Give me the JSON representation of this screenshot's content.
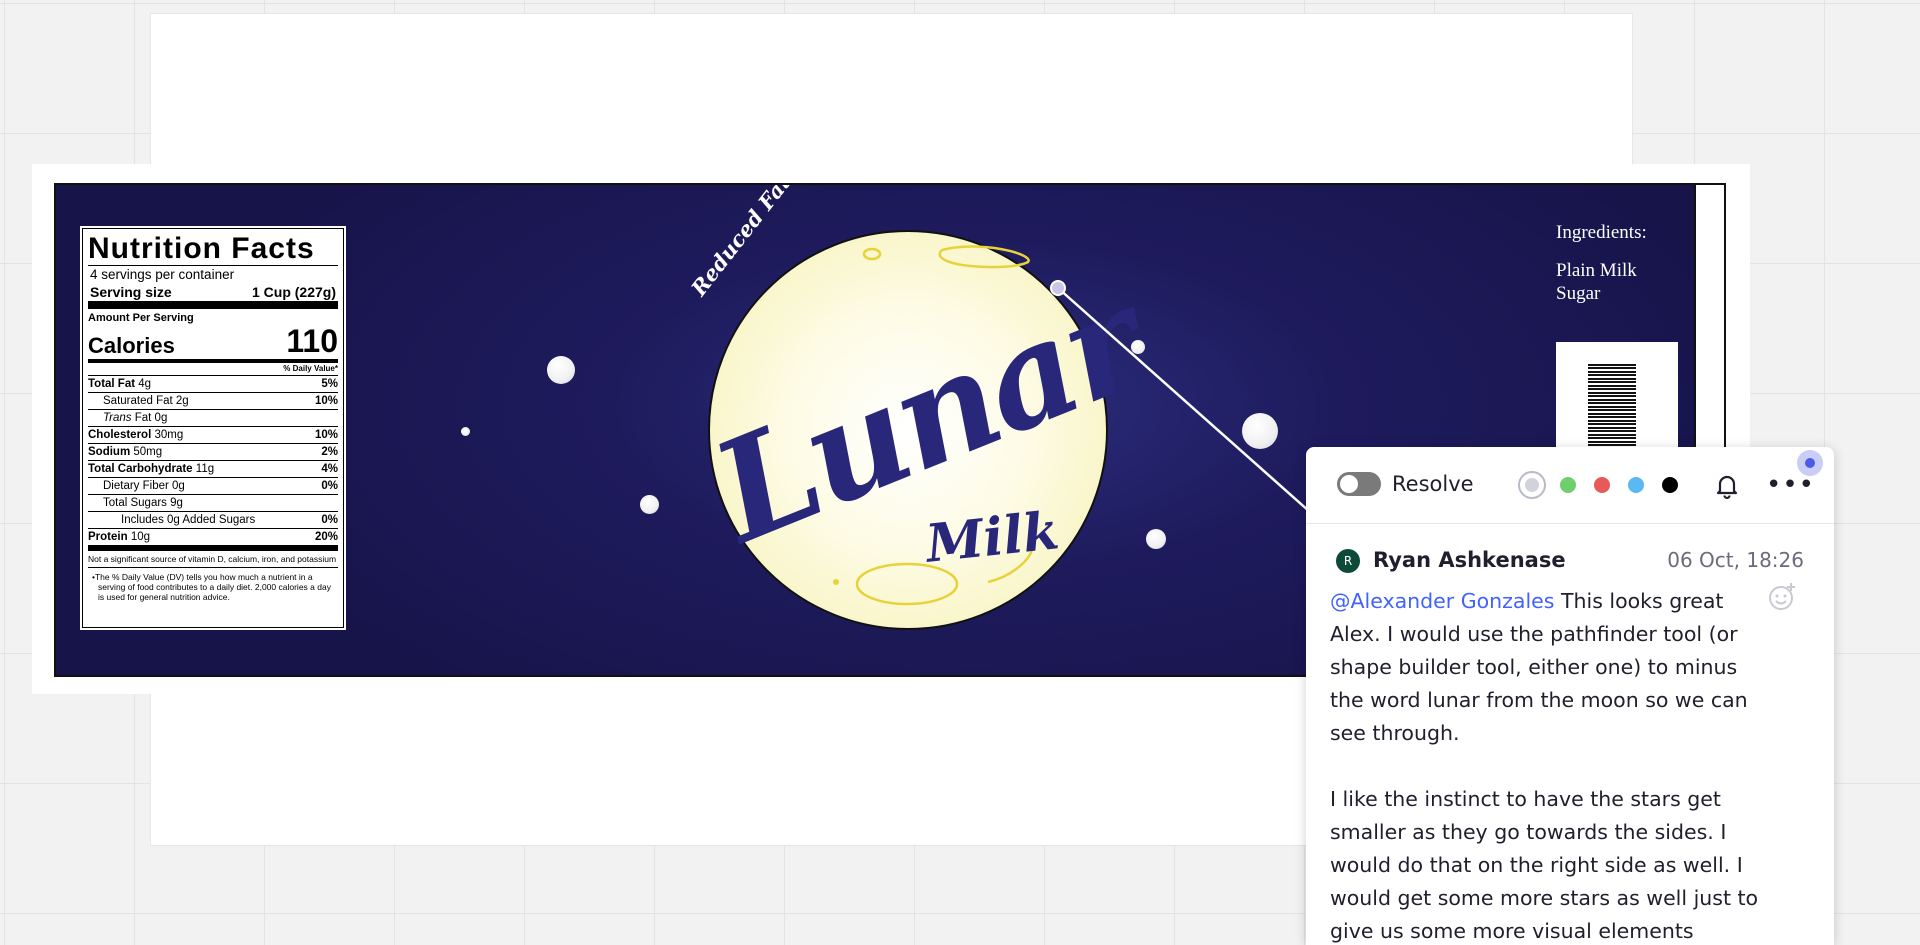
{
  "nutrition": {
    "title": "Nutrition Facts",
    "servings": "4 servings per container",
    "serving_size_label": "Serving size",
    "serving_size_value": "1 Cup (227g)",
    "amount_per_serving": "Amount Per Serving",
    "calories_label": "Calories",
    "calories_value": "110",
    "daily_value_header": "% Daily Value*",
    "rows": {
      "total_fat": {
        "name": "Total Fat",
        "amount": " 4g",
        "pct": "5%"
      },
      "saturated_fat": {
        "name": "Saturated Fat 2g",
        "pct": "10%"
      },
      "trans_fat": {
        "name_italic": "Trans",
        "name_rest": " Fat 0g",
        "pct": ""
      },
      "cholesterol": {
        "name": "Cholesterol",
        "amount": " 30mg",
        "pct": "10%"
      },
      "sodium": {
        "name": "Sodium",
        "amount": " 50mg",
        "pct": "2%"
      },
      "total_carb": {
        "name": "Total Carbohydrate",
        "amount": " 11g",
        "pct": "4%"
      },
      "dietary_fiber": {
        "name": "Dietary Fiber 0g",
        "pct": "0%"
      },
      "total_sugars": {
        "name": "Total Sugars 9g",
        "pct": ""
      },
      "added_sugars": {
        "name": "Includes 0g Added Sugars",
        "pct": "0%"
      },
      "protein": {
        "name": "Protein",
        "amount": " 10g",
        "pct": "20%"
      }
    },
    "note": "Not a significant source of vitamin D, calcium, iron, and potassium",
    "footnote": "•The % Daily Value (DV) tells you how much a nutrient in a serving of food contributes to a daily diet. 2,000 calories a day is used for general nutrition advice."
  },
  "label": {
    "reduced_fat": "Reduced Fat",
    "brand": "Lunar",
    "product": "Milk",
    "ingredients_heading": "Ingredients:",
    "ingredients": [
      "Plain Milk",
      "Sugar"
    ]
  },
  "comment_panel": {
    "resolve_label": "Resolve",
    "swatches": [
      "#d2d2dc",
      "#6fcf6a",
      "#e85a5a",
      "#5ab8f2",
      "#000000"
    ],
    "more_label": "•••",
    "author_initial": "R",
    "author": "Ryan Ashkenase",
    "date": "06 Oct, 18:26",
    "mention": "@Alexander Gonzales",
    "message_1": " This looks great Alex. I would use the pathfinder tool (or shape builder tool, either one) to minus the word lunar from the moon so we can see through.",
    "message_2": "I like the instinct to have the stars get smaller as they go towards the sides.  I would do that on the right side as well. I would get some more stars as well just to give us some more visual elements"
  },
  "colors": {
    "label_navy": "#1e1b5d",
    "lunar_text": "#28277a",
    "mention_blue": "#4262ff",
    "pin_blue": "#4a5ce8"
  }
}
